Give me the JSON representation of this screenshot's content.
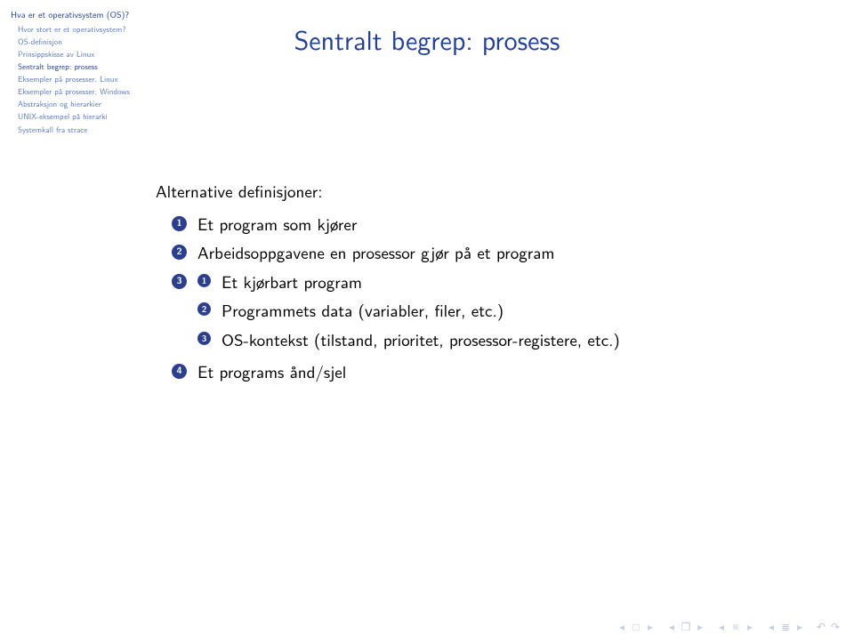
{
  "title": "Sentralt begrep: prosess",
  "sidebar": {
    "section": "Hva er et operativsystem (OS)?",
    "items": [
      "Hvor stort er et operativsystem?",
      "OS-definisjon",
      "Prinsippskisse av Linux",
      "Sentralt begrep: prosess",
      "Eksempler på prosesser, Linux",
      "Eksempler på prosesser, Windows",
      "Abstraksjon og hierarkier",
      "UNIX-eksempel på hierarki",
      "Systemkall fra strace"
    ],
    "current_index": 3
  },
  "content": {
    "intro": "Alternative definisjoner:",
    "items": [
      {
        "n": "1",
        "text": "Et program som kjører"
      },
      {
        "n": "2",
        "text": "Arbeidsoppgavene en prosessor gjør på et program"
      },
      {
        "n": "3",
        "text": "",
        "children": [
          {
            "n": "1",
            "text": "Et kjørbart program"
          },
          {
            "n": "2",
            "text": "Programmets data (variabler, filer, etc.)"
          },
          {
            "n": "3",
            "text": "OS-kontekst (tilstand, prioritet, prosessor-registere, etc.)"
          }
        ]
      },
      {
        "n": "4",
        "text": "Et programs ånd/sjel"
      }
    ]
  },
  "nav": {
    "square": "□",
    "frame1": "❐",
    "frame2": "≡",
    "frame3": "≣",
    "left": "◂",
    "right": "▸",
    "back": "↶",
    "fwd": "↷"
  }
}
